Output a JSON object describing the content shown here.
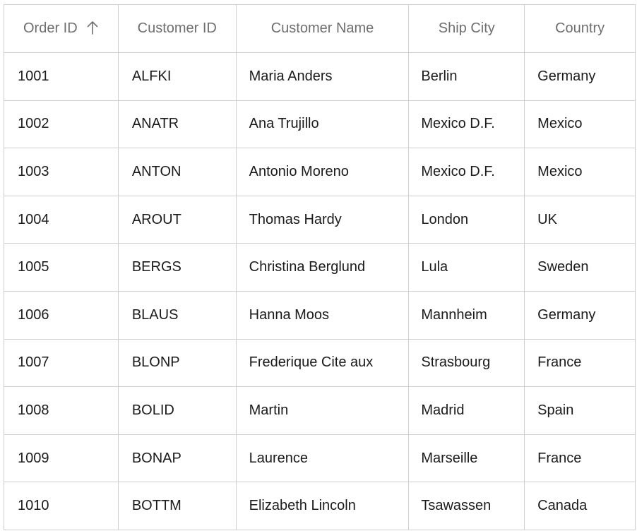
{
  "grid": {
    "columns": [
      {
        "key": "order_id",
        "label": "Order ID",
        "sorted": "ascending"
      },
      {
        "key": "customer_id",
        "label": "Customer ID"
      },
      {
        "key": "customer_name",
        "label": "Customer Name"
      },
      {
        "key": "ship_city",
        "label": "Ship City"
      },
      {
        "key": "country",
        "label": "Country"
      }
    ],
    "rows": [
      [
        "1001",
        "ALFKI",
        "Maria Anders",
        "Berlin",
        "Germany"
      ],
      [
        "1002",
        "ANATR",
        "Ana Trujillo",
        "Mexico D.F.",
        "Mexico"
      ],
      [
        "1003",
        "ANTON",
        "Antonio Moreno",
        "Mexico D.F.",
        "Mexico"
      ],
      [
        "1004",
        "AROUT",
        "Thomas Hardy",
        "London",
        "UK"
      ],
      [
        "1005",
        "BERGS",
        "Christina Berglund",
        "Lula",
        "Sweden"
      ],
      [
        "1006",
        "BLAUS",
        "Hanna Moos",
        "Mannheim",
        "Germany"
      ],
      [
        "1007",
        "BLONP",
        "Frederique Cite aux",
        "Strasbourg",
        "France"
      ],
      [
        "1008",
        "BOLID",
        "Martin",
        "Madrid",
        "Spain"
      ],
      [
        "1009",
        "BONAP",
        "Laurence",
        "Marseille",
        "France"
      ],
      [
        "1010",
        "BOTTM",
        "Elizabeth Lincoln",
        "Tsawassen",
        "Canada"
      ]
    ]
  },
  "icons": {
    "sort": "arrow-up-icon"
  },
  "colors": {
    "grid_line": "#cfcfcf",
    "header_text": "#6e6e6e",
    "cell_text": "#1b1b1b"
  }
}
